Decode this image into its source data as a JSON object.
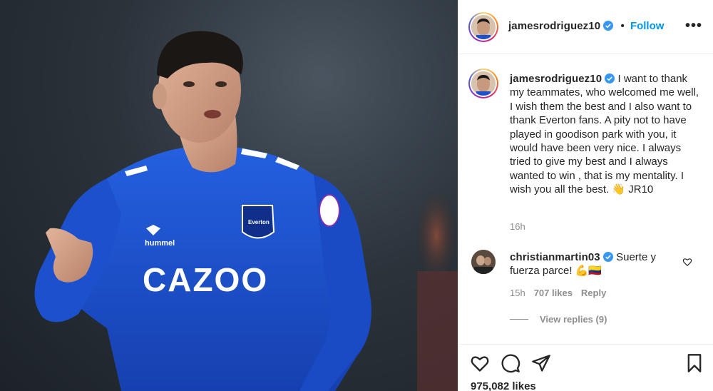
{
  "post": {
    "author": {
      "username": "jamesrodriguez10",
      "verified": true
    },
    "follow_label": "Follow",
    "separator": "•",
    "more_label": "•••",
    "caption": "I want to thank my teammates, who welcomed me well, I wish them the best and I also want to thank Everton fans. A pity not to have played in goodison park with you, it would have been very nice. I always tried to give my best and I always wanted to win , that is my mentality. I wish you all the best. 👋 JR10",
    "caption_time": "16h",
    "likes": "975,082 likes"
  },
  "photo": {
    "shirt_sponsor": "CAZOO",
    "shirt_brand": "hummel",
    "crest_text": "Everton",
    "jersey_color": "#1c4fd1"
  },
  "comments": [
    {
      "username": "christianmartin03",
      "verified": true,
      "text": "Suerte y fuerza parce! 💪🇨🇴",
      "time": "15h",
      "likes": "707 likes",
      "reply_label": "Reply",
      "view_replies": "View replies (9)"
    }
  ],
  "icons": {
    "like": "heart-icon",
    "comment": "comment-icon",
    "share": "send-icon",
    "save": "bookmark-icon"
  },
  "colors": {
    "link": "#0095f6",
    "text": "#262626",
    "muted": "#8e8e8e",
    "border": "#efefef"
  }
}
